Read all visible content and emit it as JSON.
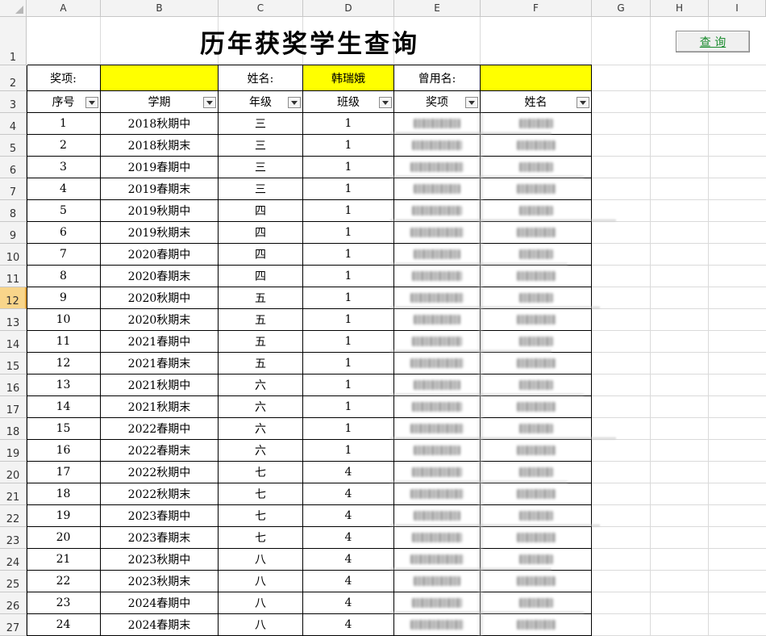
{
  "columns": [
    "A",
    "B",
    "C",
    "D",
    "E",
    "F",
    "G",
    "H",
    "I"
  ],
  "rows": [
    "1",
    "2",
    "3",
    "4",
    "5",
    "6",
    "7",
    "8",
    "9",
    "10",
    "11",
    "12",
    "13",
    "14",
    "15",
    "16",
    "17",
    "18",
    "19",
    "20",
    "21",
    "22",
    "23",
    "24",
    "25",
    "26",
    "27"
  ],
  "selected_row": "12",
  "title": "历年获奖学生查询",
  "query_button": "查 询",
  "criteria": {
    "award_label": "奖项:",
    "award_value": "",
    "name_label": "姓名:",
    "name_value": "韩瑞娥",
    "former_label": "曾用名:",
    "former_value": ""
  },
  "headers": [
    "序号",
    "学期",
    "年级",
    "班级",
    "奖项",
    "姓名"
  ],
  "records": [
    [
      "1",
      "2018秋期中",
      "三",
      "1"
    ],
    [
      "2",
      "2018秋期末",
      "三",
      "1"
    ],
    [
      "3",
      "2019春期中",
      "三",
      "1"
    ],
    [
      "4",
      "2019春期末",
      "三",
      "1"
    ],
    [
      "5",
      "2019秋期中",
      "四",
      "1"
    ],
    [
      "6",
      "2019秋期末",
      "四",
      "1"
    ],
    [
      "7",
      "2020春期中",
      "四",
      "1"
    ],
    [
      "8",
      "2020春期末",
      "四",
      "1"
    ],
    [
      "9",
      "2020秋期中",
      "五",
      "1"
    ],
    [
      "10",
      "2020秋期末",
      "五",
      "1"
    ],
    [
      "11",
      "2021春期中",
      "五",
      "1"
    ],
    [
      "12",
      "2021春期末",
      "五",
      "1"
    ],
    [
      "13",
      "2021秋期中",
      "六",
      "1"
    ],
    [
      "14",
      "2021秋期末",
      "六",
      "1"
    ],
    [
      "15",
      "2022春期中",
      "六",
      "1"
    ],
    [
      "16",
      "2022春期末",
      "六",
      "1"
    ],
    [
      "17",
      "2022秋期中",
      "七",
      "4"
    ],
    [
      "18",
      "2022秋期末",
      "七",
      "4"
    ],
    [
      "19",
      "2023春期中",
      "七",
      "4"
    ],
    [
      "20",
      "2023春期末",
      "七",
      "4"
    ],
    [
      "21",
      "2023秋期中",
      "八",
      "4"
    ],
    [
      "22",
      "2023秋期末",
      "八",
      "4"
    ],
    [
      "23",
      "2024春期中",
      "八",
      "4"
    ],
    [
      "24",
      "2024春期末",
      "八",
      "4"
    ]
  ],
  "colors": {
    "highlight": "#ffff00",
    "button_text": "#1a8b2e",
    "selected_row_header": "#f8d58a"
  }
}
